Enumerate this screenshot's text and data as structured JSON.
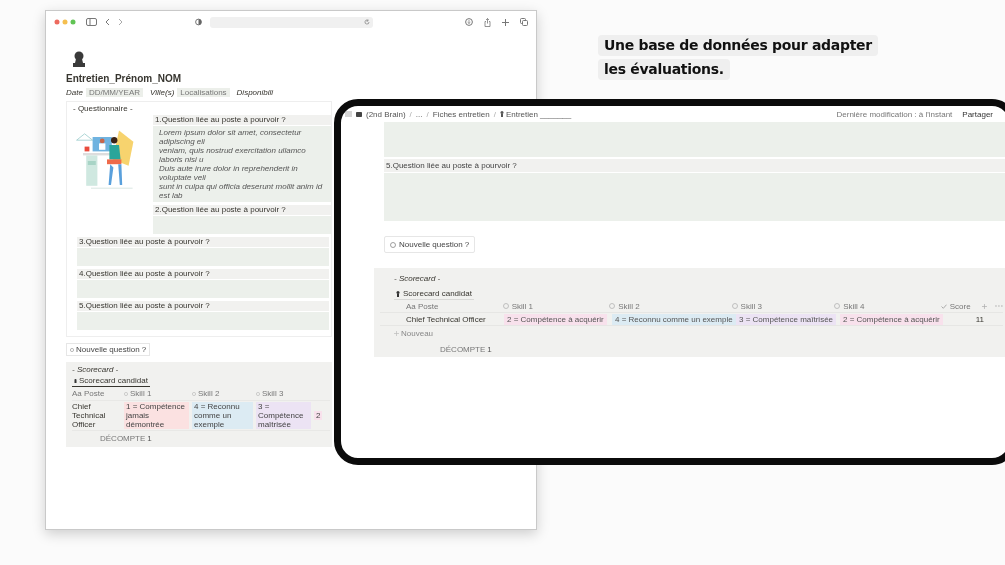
{
  "caption": {
    "lines": [
      "Une base de données pour adapter",
      "les évaluations."
    ]
  },
  "browser": {
    "title": "Entretien_Prénom_NOM",
    "properties": [
      {
        "label": "Date",
        "placeholder": "DD/MM/YEAR"
      },
      {
        "label": "Ville(s)",
        "placeholder": "Localisations"
      },
      {
        "label": "Disponibili"
      }
    ],
    "section": "- Questionnaire -",
    "questions": [
      {
        "title": "1.Question liée au poste à pourvoir ?",
        "answer": [
          "Lorem ipsum dolor sit amet, consectetur adipiscing eli",
          "veniam, quis nostrud exercitation ullamco laboris nisi u",
          "Duis aute irure dolor in reprehenderit in voluptate veli",
          "sunt in culpa qui officia deserunt mollit anim id est lab"
        ]
      },
      {
        "title": "2.Question liée au poste à pourvoir ?"
      },
      {
        "title": "3.Question liée au poste à pourvoir ?"
      },
      {
        "title": "4.Question liée au poste à pourvoir ?"
      },
      {
        "title": "5.Question liée au poste à pourvoir ?"
      }
    ],
    "new_question": "Nouvelle question ?",
    "scorecard": {
      "label": "- Scorecard -",
      "tabs": [
        {
          "label": "Scorecard candidat",
          "selected": true
        }
      ],
      "columns": [
        "Aa Poste",
        "Skill 1",
        "Skill 2",
        "Skill 3"
      ],
      "rows": [
        {
          "poste": "Chief Technical Officer",
          "skills": [
            {
              "text": "1 = Compétence jamais démontrée",
              "color": "#fbe1e1"
            },
            {
              "text": "4 = Reconnu comme un exemple",
              "color": "#dcebf3"
            },
            {
              "text": "3 = Compétence maîtrisée",
              "color": "#ece3f4"
            },
            {
              "text": "2",
              "color": "#f8e1ec"
            }
          ]
        }
      ],
      "count_label": "DÉCOMPTE",
      "count": "1"
    }
  },
  "tablet": {
    "breadcrumb": [
      {
        "kind": "crumb",
        "text": "(2nd Brain)"
      },
      {
        "kind": "sep",
        "text": "/"
      },
      {
        "kind": "crumb",
        "text": "..."
      },
      {
        "kind": "sep",
        "text": "/"
      },
      {
        "kind": "crumb",
        "text": "Fiches entretien"
      },
      {
        "kind": "sep",
        "text": "/"
      },
      {
        "kind": "page",
        "text": "Entretien _______"
      }
    ],
    "modified": "Dernière modification : à l'instant",
    "share": "Partager",
    "question": {
      "title": "5.Question liée au poste à pourvoir ?"
    },
    "new_question": "Nouvelle question ?",
    "scorecard": {
      "label": "- Scorecard -",
      "tabs": [
        {
          "label": "Scorecard candidat",
          "selected": true
        }
      ],
      "columns": [
        "Aa Poste",
        "Skill 1",
        "Skill 2",
        "Skill 3",
        "Skill 4",
        "Score"
      ],
      "rows": [
        {
          "poste": "Chief Technical Officer",
          "skills": [
            {
              "text": "2 = Compétence à acquérir",
              "color": "#f8e1ec"
            },
            {
              "text": "4 = Reconnu comme un exemple",
              "color": "#dcebf3"
            },
            {
              "text": "3 = Compétence maîtrisée",
              "color": "#ece3f4"
            },
            {
              "text": "2 = Compétence à acquérir",
              "color": "#f8e1ec"
            }
          ],
          "score": "11"
        }
      ],
      "new_row": "Nouveau",
      "count_label": "DÉCOMPTE",
      "count": "1"
    }
  }
}
